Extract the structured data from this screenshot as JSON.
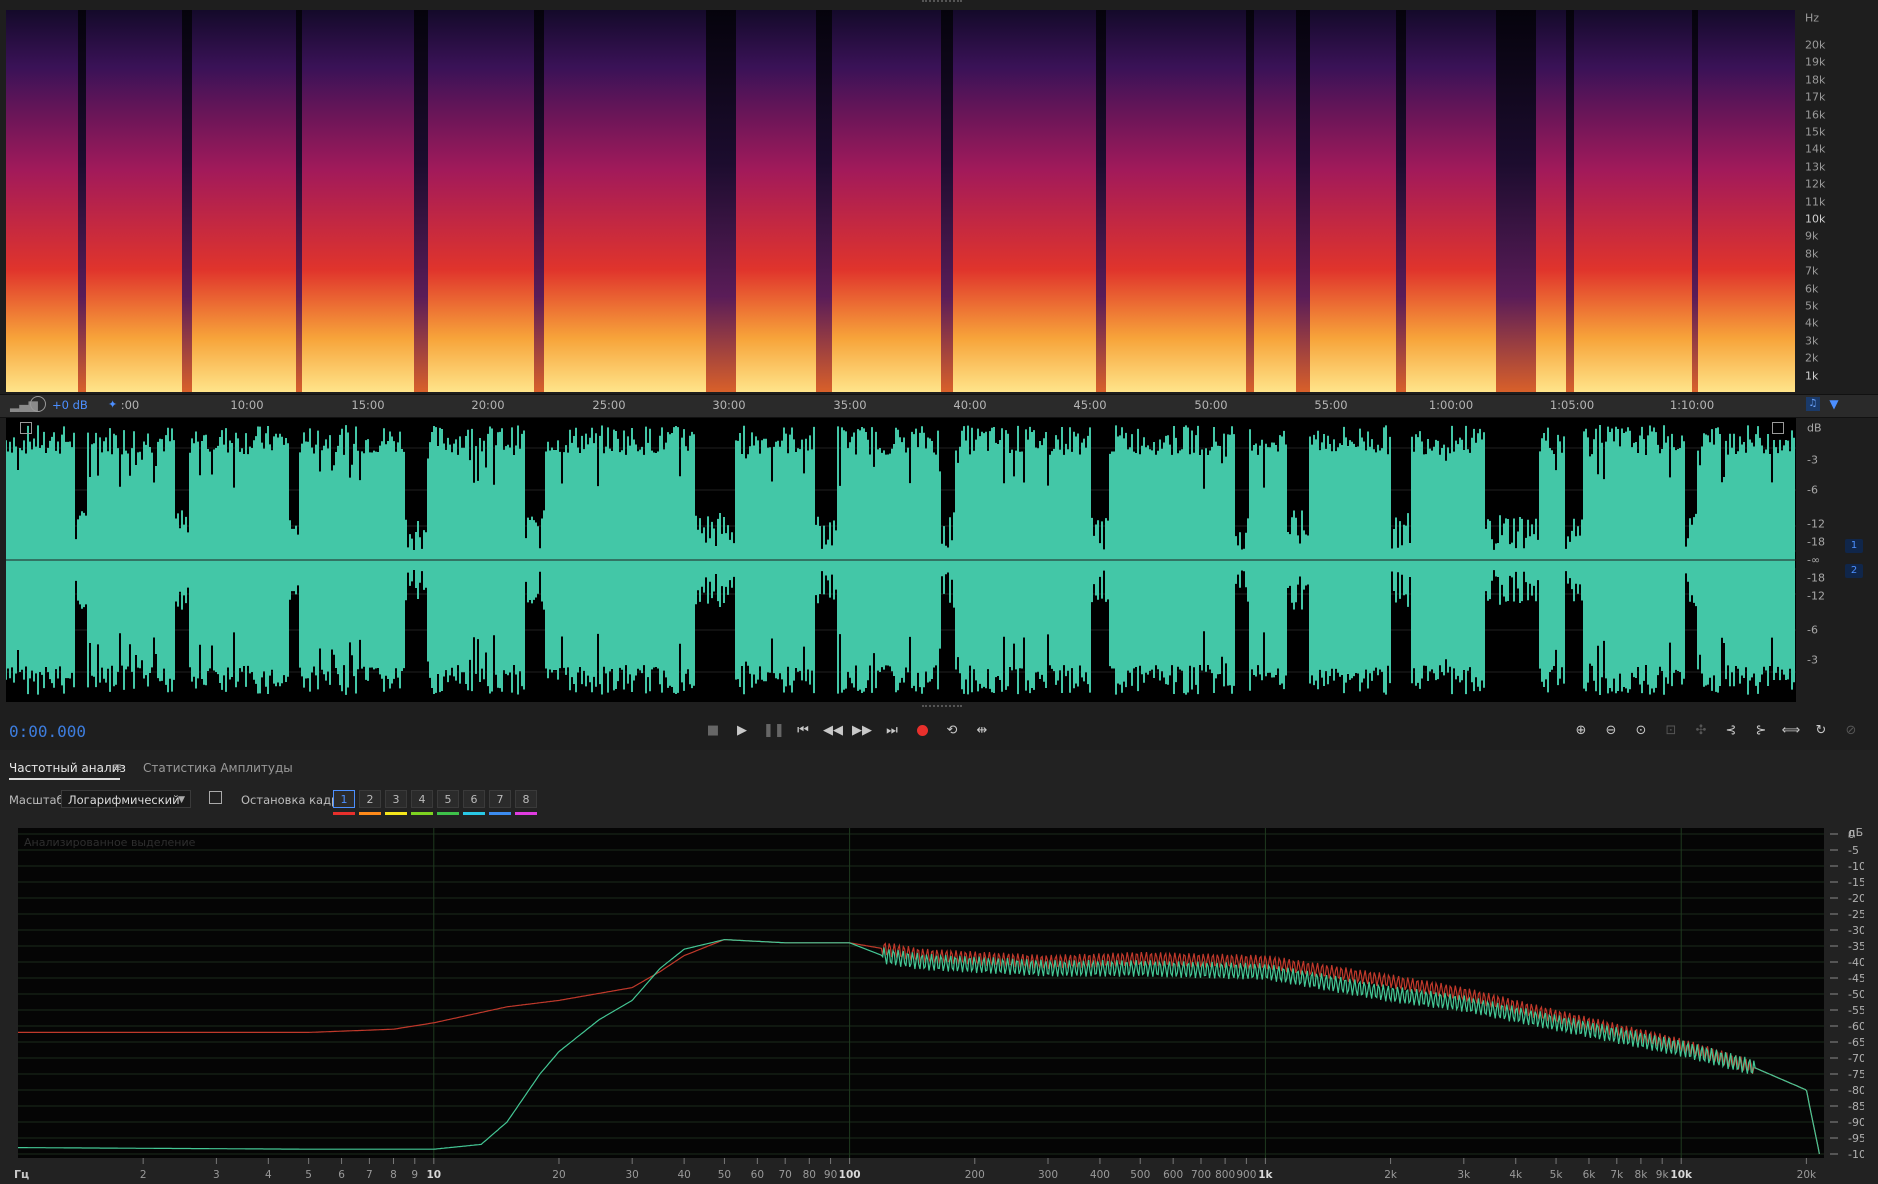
{
  "spectrogram": {
    "unit_label": "Hz",
    "freq_labels": [
      "20k",
      "19k",
      "18k",
      "17k",
      "16k",
      "15k",
      "14k",
      "13k",
      "12k",
      "11k",
      "10k",
      "9k",
      "8k",
      "7k",
      "6k",
      "5k",
      "4k",
      "3k",
      "2k",
      "1k"
    ],
    "bold_labels": [
      "10k",
      "1k"
    ]
  },
  "header_controls": {
    "volume_label": "+0 dB"
  },
  "ruler": {
    "ticks": [
      ":00",
      "10:00",
      "15:00",
      "20:00",
      "25:00",
      "30:00",
      "35:00",
      "40:00",
      "45:00",
      "50:00",
      "55:00",
      "1:00:00",
      "1:05:00",
      "1:10:00"
    ]
  },
  "waveform": {
    "color": "#43c7a7",
    "unit_label": "dB",
    "db_labels": [
      "-3",
      "-6",
      "-12",
      "-18",
      "-∞",
      "-18",
      "-12",
      "-6",
      "-3"
    ],
    "channels": [
      "1",
      "2"
    ]
  },
  "transport": {
    "timecode": "0:00.000",
    "record_color": "#e8302c"
  },
  "panel": {
    "tabs": [
      "Частотный анализ",
      "Статистика Амплитуды"
    ],
    "scale_label": "Масштаб:",
    "scale_value": "Логарифмический",
    "freeze_label": "Остановка кадра:",
    "freeze_buttons": [
      "1",
      "2",
      "3",
      "4",
      "5",
      "6",
      "7",
      "8"
    ],
    "freeze_colors": [
      "#e8302c",
      "#ff8a1a",
      "#f5e61c",
      "#7ed321",
      "#3ec24a",
      "#29c8e6",
      "#3c8cf0",
      "#e03ce0"
    ]
  },
  "frequency_analysis": {
    "caption": "Анализированное выделение",
    "db_unit": "дБ",
    "hz_unit": "Гц",
    "db_ticks": [
      "0",
      "-5",
      "-10",
      "-15",
      "-20",
      "-25",
      "-30",
      "-35",
      "-40",
      "-45",
      "-50",
      "-55",
      "-60",
      "-65",
      "-70",
      "-75",
      "-80",
      "-85",
      "-90",
      "-95",
      "-100"
    ],
    "x_ticks": [
      {
        "label": "2",
        "f": 2
      },
      {
        "label": "3",
        "f": 3
      },
      {
        "label": "4",
        "f": 4
      },
      {
        "label": "5",
        "f": 5
      },
      {
        "label": "6",
        "f": 6
      },
      {
        "label": "7",
        "f": 7
      },
      {
        "label": "8",
        "f": 8
      },
      {
        "label": "9",
        "f": 9
      },
      {
        "label": "10",
        "f": 10,
        "bold": true
      },
      {
        "label": "20",
        "f": 20
      },
      {
        "label": "30",
        "f": 30
      },
      {
        "label": "40",
        "f": 40
      },
      {
        "label": "50",
        "f": 50
      },
      {
        "label": "60",
        "f": 60
      },
      {
        "label": "70",
        "f": 70
      },
      {
        "label": "80",
        "f": 80
      },
      {
        "label": "90",
        "f": 90
      },
      {
        "label": "100",
        "f": 100,
        "bold": true
      },
      {
        "label": "200",
        "f": 200
      },
      {
        "label": "300",
        "f": 300
      },
      {
        "label": "400",
        "f": 400
      },
      {
        "label": "500",
        "f": 500
      },
      {
        "label": "600",
        "f": 600
      },
      {
        "label": "700",
        "f": 700
      },
      {
        "label": "800",
        "f": 800
      },
      {
        "label": "900",
        "f": 900
      },
      {
        "label": "1k",
        "f": 1000,
        "bold": true
      },
      {
        "label": "2k",
        "f": 2000
      },
      {
        "label": "3k",
        "f": 3000
      },
      {
        "label": "4k",
        "f": 4000
      },
      {
        "label": "5k",
        "f": 5000
      },
      {
        "label": "6k",
        "f": 6000
      },
      {
        "label": "7k",
        "f": 7000
      },
      {
        "label": "8k",
        "f": 8000
      },
      {
        "label": "9k",
        "f": 9000
      },
      {
        "label": "10k",
        "f": 10000,
        "bold": true
      },
      {
        "label": "20k",
        "f": 20000
      }
    ]
  },
  "chart_data": {
    "type": "line",
    "xlabel": "Гц",
    "ylabel": "дБ",
    "x_scale": "log",
    "xlim": [
      1,
      22050
    ],
    "ylim": [
      -100,
      0
    ],
    "series": [
      {
        "color": "#c0392b",
        "points": [
          [
            1,
            -62
          ],
          [
            5,
            -62
          ],
          [
            8,
            -61
          ],
          [
            10,
            -59
          ],
          [
            15,
            -54
          ],
          [
            20,
            -52
          ],
          [
            30,
            -48
          ],
          [
            35,
            -43
          ],
          [
            40,
            -38
          ],
          [
            50,
            -33
          ],
          [
            70,
            -34
          ],
          [
            100,
            -34
          ],
          [
            150,
            -38
          ],
          [
            300,
            -40
          ],
          [
            500,
            -39
          ],
          [
            1000,
            -40
          ],
          [
            2000,
            -46
          ],
          [
            3000,
            -50
          ],
          [
            5000,
            -57
          ],
          [
            10000,
            -66
          ],
          [
            15000,
            -73
          ],
          [
            20000,
            -80
          ],
          [
            21500,
            -100
          ]
        ]
      },
      {
        "color": "#44c795",
        "points": [
          [
            1,
            -98
          ],
          [
            5,
            -98.5
          ],
          [
            10,
            -98.5
          ],
          [
            13,
            -97
          ],
          [
            15,
            -90
          ],
          [
            18,
            -75
          ],
          [
            20,
            -68
          ],
          [
            25,
            -58
          ],
          [
            30,
            -52
          ],
          [
            35,
            -42
          ],
          [
            40,
            -36
          ],
          [
            50,
            -33
          ],
          [
            70,
            -34
          ],
          [
            100,
            -34
          ],
          [
            120,
            -38
          ],
          [
            150,
            -40
          ],
          [
            300,
            -42
          ],
          [
            500,
            -42
          ],
          [
            1000,
            -43
          ],
          [
            2000,
            -50
          ],
          [
            3000,
            -53
          ],
          [
            5000,
            -59
          ],
          [
            10000,
            -67
          ],
          [
            15000,
            -73
          ],
          [
            20000,
            -80
          ],
          [
            21500,
            -100
          ]
        ]
      }
    ]
  }
}
